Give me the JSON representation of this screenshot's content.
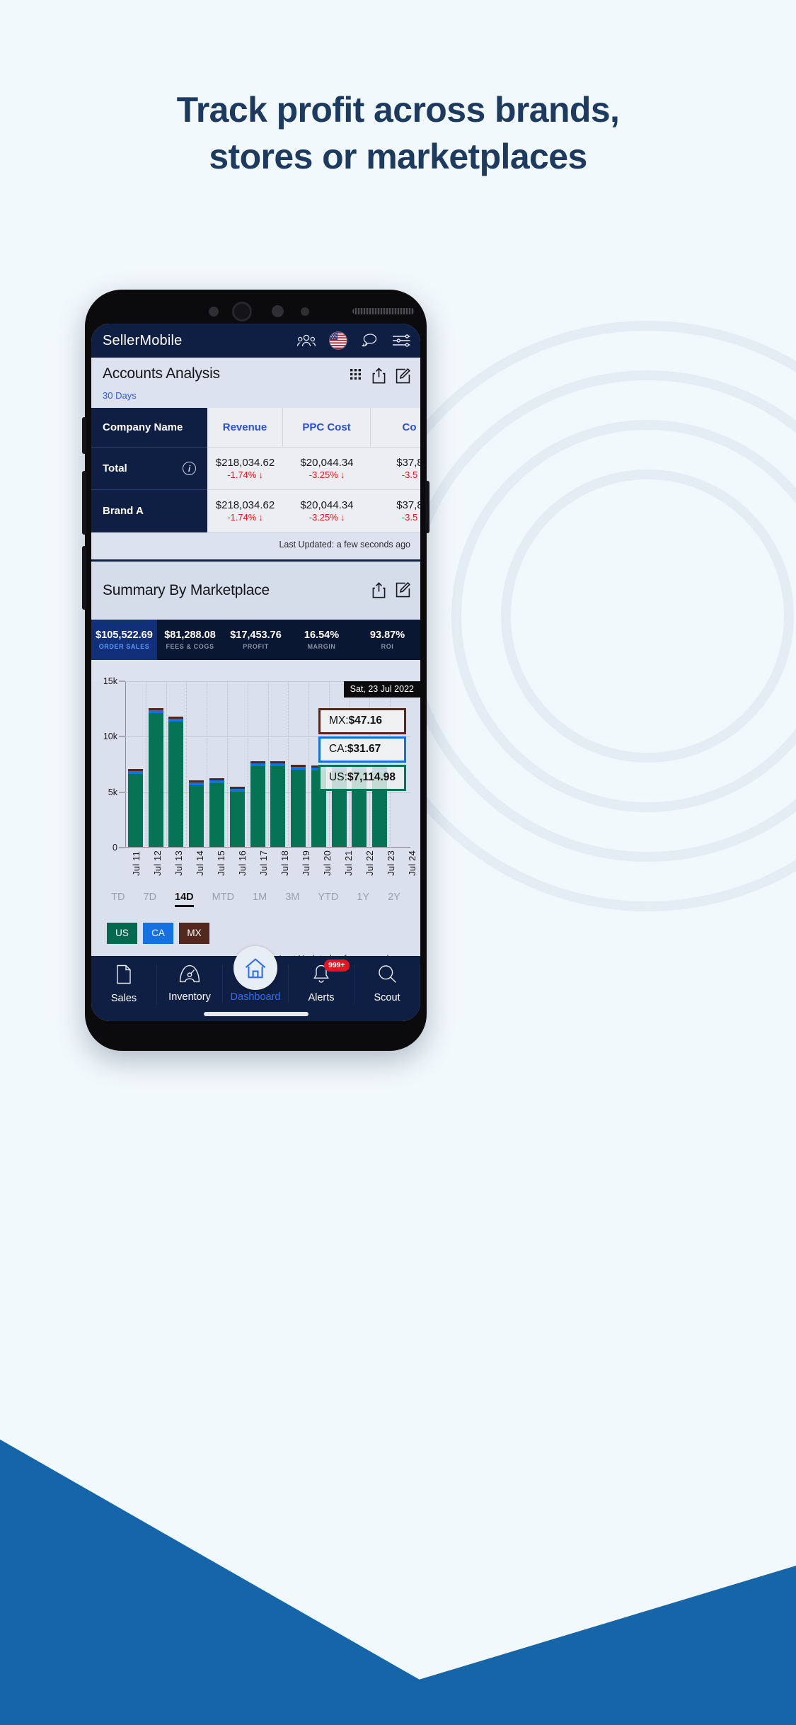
{
  "headline": {
    "line1": "Track profit across brands,",
    "line2": "stores or marketplaces"
  },
  "colors": {
    "page_bg": "#f2f9fd",
    "headline": "#1d3a5f",
    "wedge_blue": "#1565a8",
    "navy": "#0f1f44",
    "accent_blue": "#2650d8",
    "negative_red": "#e01b1b",
    "us_green": "#067355",
    "ca_blue": "#1571e0",
    "mx_brown": "#53281c"
  },
  "app": {
    "title": "SellerMobile",
    "header_icons": [
      "users-icon",
      "us-flag-icon",
      "chat-icon",
      "filter-sliders-icon"
    ]
  },
  "accounts_analysis": {
    "title": "Accounts Analysis",
    "subtitle": "30 Days",
    "actions": [
      "grid-icon",
      "share-icon",
      "edit-icon"
    ],
    "columns": [
      "Company Name",
      "Revenue",
      "PPC Cost",
      "Co"
    ],
    "rows": [
      {
        "name": "Total",
        "info_icon": "i",
        "cells": [
          {
            "value": "$218,034.62",
            "delta": "-1.74%",
            "arrow": "↓"
          },
          {
            "value": "$20,044.34",
            "delta": "-3.25%",
            "arrow": "↓"
          },
          {
            "value": "$37,8",
            "delta": "-3.5",
            "arrow": ""
          }
        ]
      },
      {
        "name": "Brand A",
        "info_icon": "",
        "cells": [
          {
            "value": "$218,034.62",
            "delta": "-1.74%",
            "arrow": "↓"
          },
          {
            "value": "$20,044.34",
            "delta": "-3.25%",
            "arrow": "↓"
          },
          {
            "value": "$37,8",
            "delta": "-3.5",
            "arrow": ""
          }
        ]
      }
    ],
    "last_updated": "Last Updated: a few seconds ago"
  },
  "summary": {
    "title": "Summary By Marketplace",
    "actions": [
      "share-icon",
      "edit-icon"
    ],
    "kpis": [
      {
        "value": "$105,522.69",
        "label": "ORDER SALES",
        "active": true
      },
      {
        "value": "$81,288.08",
        "label": "FEES & COGS",
        "active": false
      },
      {
        "value": "$17,453.76",
        "label": "PROFIT",
        "active": false
      },
      {
        "value": "16.54%",
        "label": "MARGIN",
        "active": false
      },
      {
        "value": "93.87%",
        "label": "ROI",
        "active": false
      }
    ],
    "date_badge": "Sat, 23 Jul 2022",
    "tooltips": [
      {
        "country": "MX:",
        "amount": "$47.16"
      },
      {
        "country": "CA:",
        "amount": "$31.67"
      },
      {
        "country": "US:",
        "amount": "$7,114.98"
      }
    ],
    "ranges": [
      {
        "label": "TD",
        "selected": false
      },
      {
        "label": "7D",
        "selected": false
      },
      {
        "label": "14D",
        "selected": true
      },
      {
        "label": "MTD",
        "selected": false
      },
      {
        "label": "1M",
        "selected": false
      },
      {
        "label": "3M",
        "selected": false
      },
      {
        "label": "YTD",
        "selected": false
      },
      {
        "label": "1Y",
        "selected": false
      },
      {
        "label": "2Y",
        "selected": false
      }
    ],
    "legend": [
      {
        "code": "US",
        "color": "#046a4f"
      },
      {
        "code": "CA",
        "color": "#1571e0"
      },
      {
        "code": "MX",
        "color": "#53281c"
      }
    ],
    "last_updated": "Last Updated: a few seconds ago"
  },
  "chart_data": {
    "type": "bar",
    "title": "",
    "xlabel": "",
    "ylabel": "",
    "ylim": [
      0,
      15000
    ],
    "yticks": [
      "0",
      "5k",
      "10k",
      "15k"
    ],
    "ytick_values": [
      0,
      5000,
      10000,
      15000
    ],
    "grid": true,
    "stacked": true,
    "legend_position": "bottom-left",
    "categories": [
      "Jul 11",
      "Jul 12",
      "Jul 13",
      "Jul 14",
      "Jul 15",
      "Jul 16",
      "Jul 17",
      "Jul 18",
      "Jul 19",
      "Jul 20",
      "Jul 21",
      "Jul 22",
      "Jul 23",
      "Jul 24"
    ],
    "series": [
      {
        "name": "US",
        "color": "#067355",
        "values": [
          6850,
          12300,
          11450,
          5800,
          6050,
          5300,
          7500,
          7500,
          7200,
          7200,
          7150,
          7150,
          7115,
          0
        ]
      },
      {
        "name": "CA",
        "color": "#1571e0",
        "values": [
          120,
          150,
          260,
          130,
          90,
          60,
          150,
          140,
          120,
          110,
          110,
          100,
          32,
          0
        ]
      },
      {
        "name": "MX",
        "color": "#53281c",
        "values": [
          70,
          70,
          60,
          60,
          60,
          80,
          60,
          60,
          60,
          60,
          60,
          60,
          47,
          0
        ]
      }
    ],
    "annotations": [
      {
        "label": "MX:",
        "value": "$47.16"
      },
      {
        "label": "CA:",
        "value": "$31.67"
      },
      {
        "label": "US:",
        "value": "$7,114.98"
      }
    ],
    "hover_date": "Sat, 23 Jul 2022"
  },
  "tabbar": {
    "items": [
      {
        "label": "Sales",
        "icon": "document-icon",
        "active": false,
        "badge": ""
      },
      {
        "label": "Inventory",
        "icon": "gauge-icon",
        "active": false,
        "badge": ""
      },
      {
        "label": "Dashboard",
        "icon": "home-icon",
        "active": true,
        "badge": ""
      },
      {
        "label": "Alerts",
        "icon": "bell-icon",
        "active": false,
        "badge": "999+"
      },
      {
        "label": "Scout",
        "icon": "search-icon",
        "active": false,
        "badge": ""
      }
    ]
  }
}
